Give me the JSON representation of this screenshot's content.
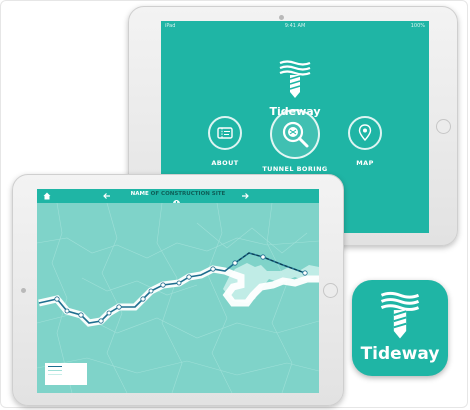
{
  "brand": {
    "name": "Tideway",
    "accent": "#1fb5a5",
    "dark": "#0e5f58"
  },
  "back_tablet": {
    "status": {
      "carrier": "iPad",
      "time": "9:41 AM",
      "battery": "100%"
    },
    "menu": [
      {
        "label": "ABOUT",
        "icon": "ticket-icon"
      },
      {
        "label": "TUNNEL BORING MACHINE",
        "icon": "tbm-magnifier-icon"
      },
      {
        "label": "MAP",
        "icon": "map-pin-icon"
      }
    ]
  },
  "front_tablet": {
    "title_strong": "NAME",
    "title_rest": " OF CONSTRUCTION SITE"
  },
  "app_icon": {
    "label": "Tideway"
  }
}
